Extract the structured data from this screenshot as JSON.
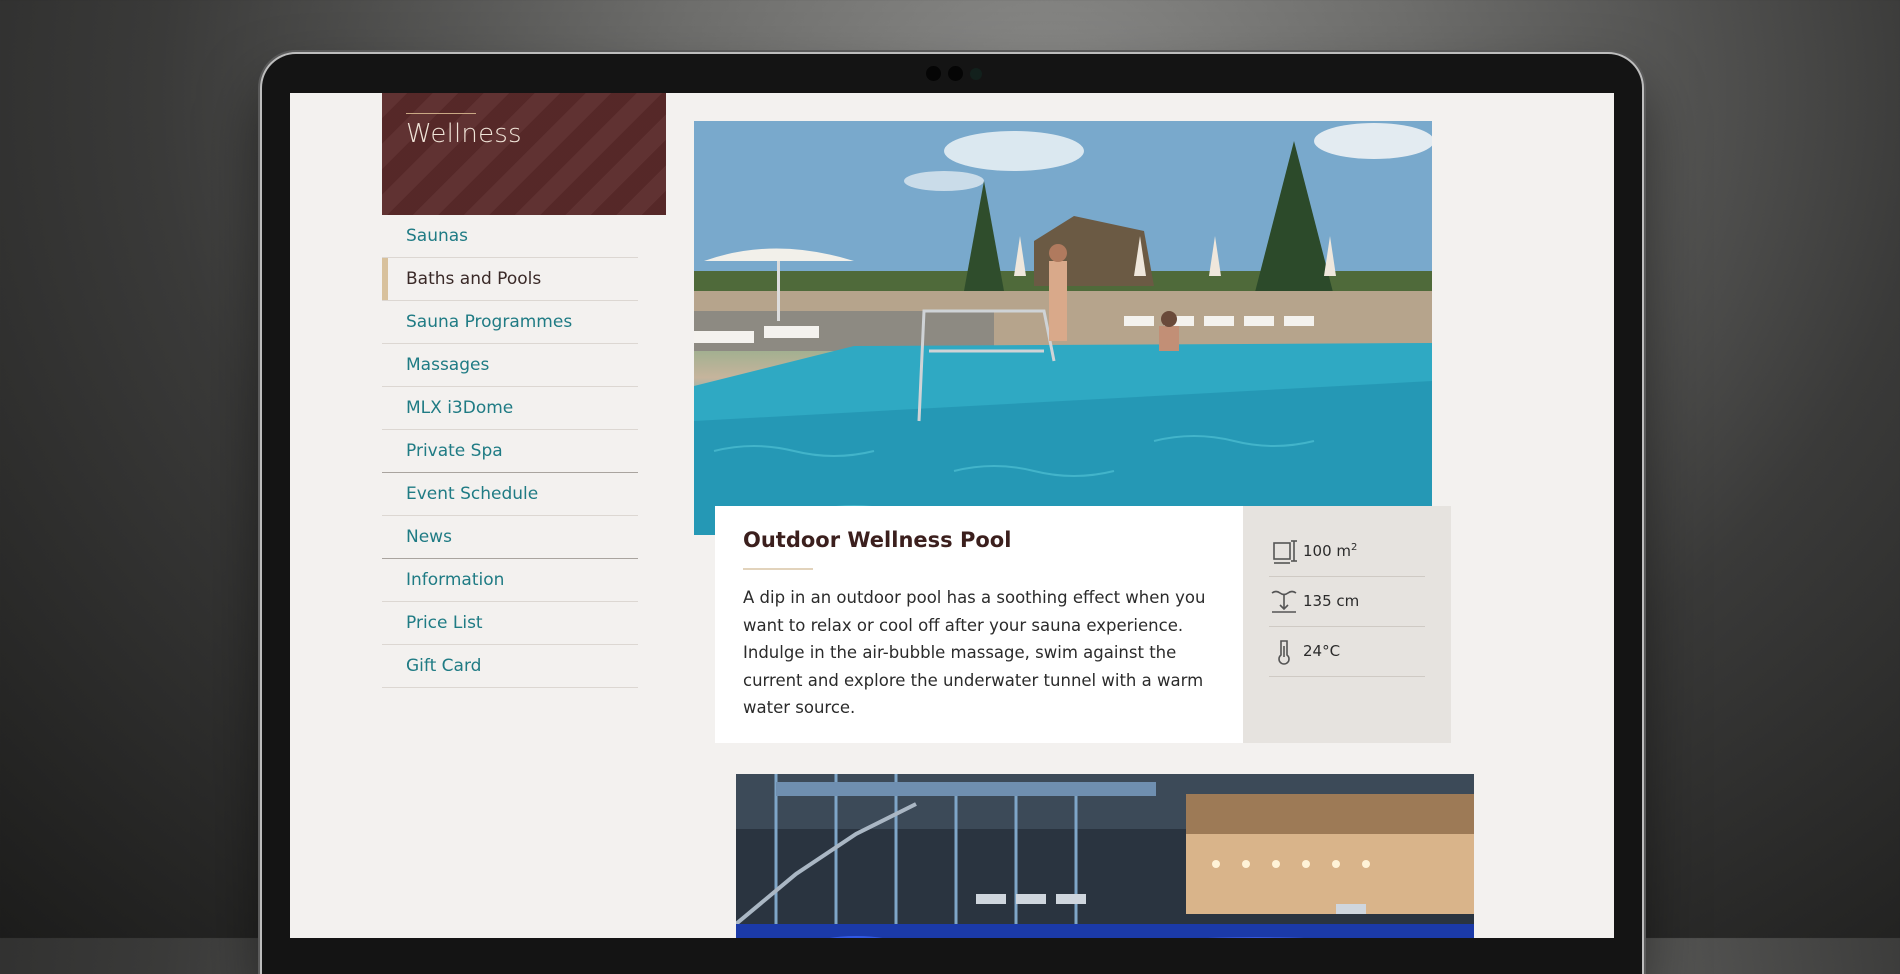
{
  "sidebar": {
    "title": "Wellness",
    "items": [
      {
        "label": "Saunas"
      },
      {
        "label": "Baths and Pools"
      },
      {
        "label": "Sauna Programmes"
      },
      {
        "label": "Massages"
      },
      {
        "label": "MLX i3Dome"
      },
      {
        "label": "Private Spa"
      },
      {
        "label": "Event Schedule"
      },
      {
        "label": "News"
      },
      {
        "label": "Information"
      },
      {
        "label": "Price List"
      },
      {
        "label": "Gift Card"
      }
    ],
    "active_index": 1
  },
  "card": {
    "title": "Outdoor Wellness Pool",
    "description": "A dip in an outdoor pool has a soothing effect when you want to relax or cool off after your sauna experience. Indulge in the air-bubble massage, swim against the current and explore the underwater tunnel with a warm water source.",
    "stats": [
      {
        "icon": "area-icon",
        "value": "100 m",
        "sup": "2"
      },
      {
        "icon": "depth-icon",
        "value": "135 cm"
      },
      {
        "icon": "thermometer-icon",
        "value": "24°C"
      }
    ]
  },
  "colors": {
    "accent_teal": "#1f7b84",
    "brand_maroon": "#5a2a2a",
    "active_marker": "#d8c19c"
  }
}
